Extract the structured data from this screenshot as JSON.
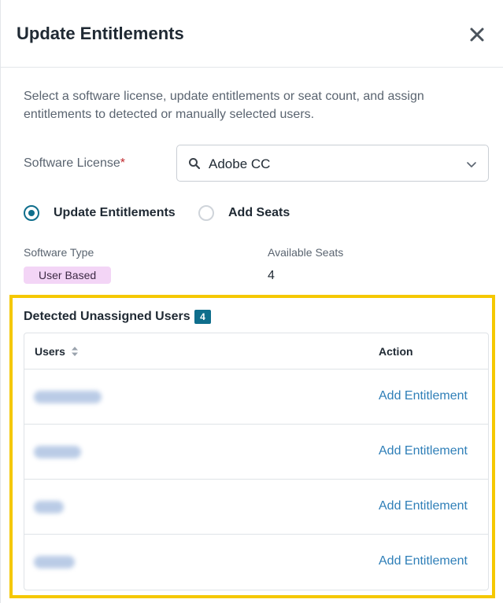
{
  "header": {
    "title": "Update Entitlements",
    "close_icon": "close-icon"
  },
  "description": "Select a software license, update entitlements or seat count, and assign entitlements to detected or manually selected users.",
  "license": {
    "label": "Software License",
    "required_mark": "*",
    "value": "Adobe CC",
    "search_icon": "search-icon",
    "chevron_icon": "chevron-down-icon"
  },
  "mode": {
    "options": [
      {
        "label": "Update Entitlements",
        "selected": true
      },
      {
        "label": "Add Seats",
        "selected": false
      }
    ]
  },
  "software_type": {
    "label": "Software Type",
    "value": "User Based"
  },
  "available_seats": {
    "label": "Available Seats",
    "value": "4"
  },
  "detected": {
    "title": "Detected Unassigned Users",
    "count": "4",
    "columns": {
      "users": "Users",
      "action": "Action"
    },
    "rows": [
      {
        "action": "Add Entitlement"
      },
      {
        "action": "Add Entitlement"
      },
      {
        "action": "Add Entitlement"
      },
      {
        "action": "Add Entitlement"
      }
    ]
  },
  "colors": {
    "accent": "#0f6e8c",
    "link": "#2f7fb8",
    "highlight": "#f5c800",
    "badge_bg": "#f3d5f6",
    "required": "#c0282d"
  }
}
